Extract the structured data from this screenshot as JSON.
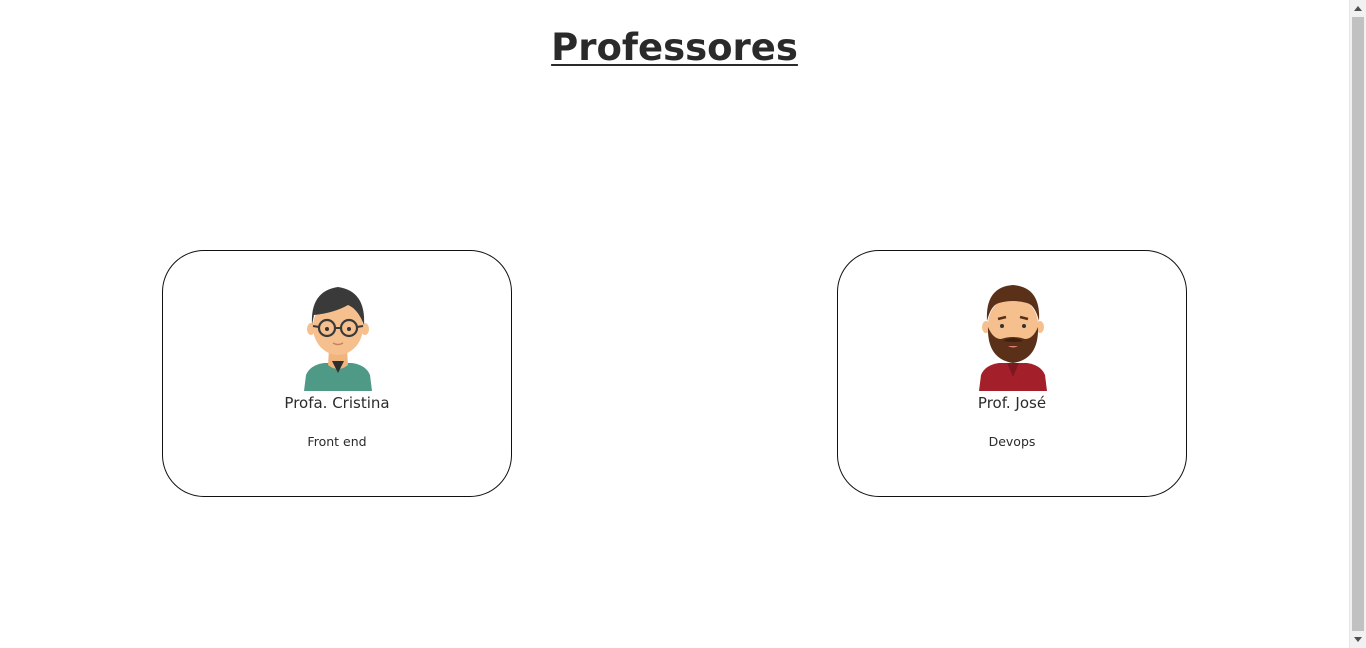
{
  "page": {
    "title": "Professores"
  },
  "cards": [
    {
      "name": "Profa. Cristina",
      "role": "Front end",
      "avatar": "woman-avatar-icon"
    },
    {
      "name": "Prof. José",
      "role": "Devops",
      "avatar": "bearded-man-avatar-icon"
    }
  ],
  "colors": {
    "shirt_teal": "#4f9a86",
    "shirt_red": "#a3202a",
    "skin": "#f5c08e",
    "hair_dark": "#3a3a3a",
    "hair_brown": "#5a3118"
  }
}
